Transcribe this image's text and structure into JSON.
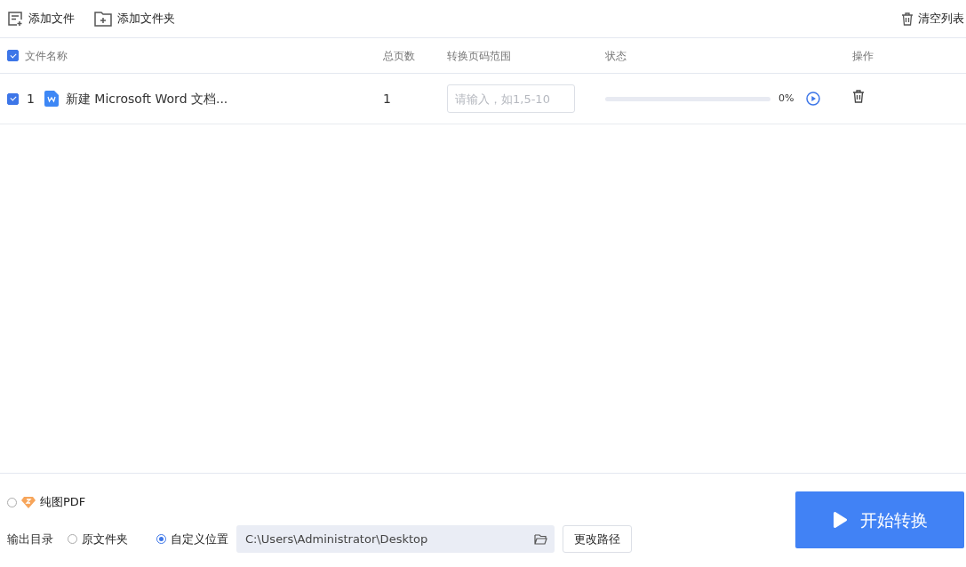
{
  "toolbar": {
    "buttons": [
      {
        "label": "添加文件",
        "kind": "file"
      },
      {
        "label": "添加文件夹",
        "kind": "folder"
      }
    ],
    "clear_button": "清空列表"
  },
  "table": {
    "header_checked": true,
    "columns": [
      "文件名称",
      "总页数",
      "转换页码范围",
      "状态",
      "操作"
    ],
    "rows": [
      {
        "checked": true,
        "index": "1",
        "name": "新建 Microsoft Word 文档...",
        "pages": "1",
        "range_placeholder": "请输入，如1,5-10",
        "level": 0,
        "progress": "0%"
      }
    ]
  },
  "pure_pdf": {
    "label": "纯图PDF",
    "selected": false
  },
  "output": {
    "label": "输出目录",
    "choices": [
      {
        "label": "原文件夹",
        "selected": false
      },
      {
        "label": "自定义位置",
        "selected": true
      }
    ],
    "path": "C:\\Users\\Administrator\\Desktop",
    "change_button": "更改路径"
  },
  "start_button": "开始转换"
}
